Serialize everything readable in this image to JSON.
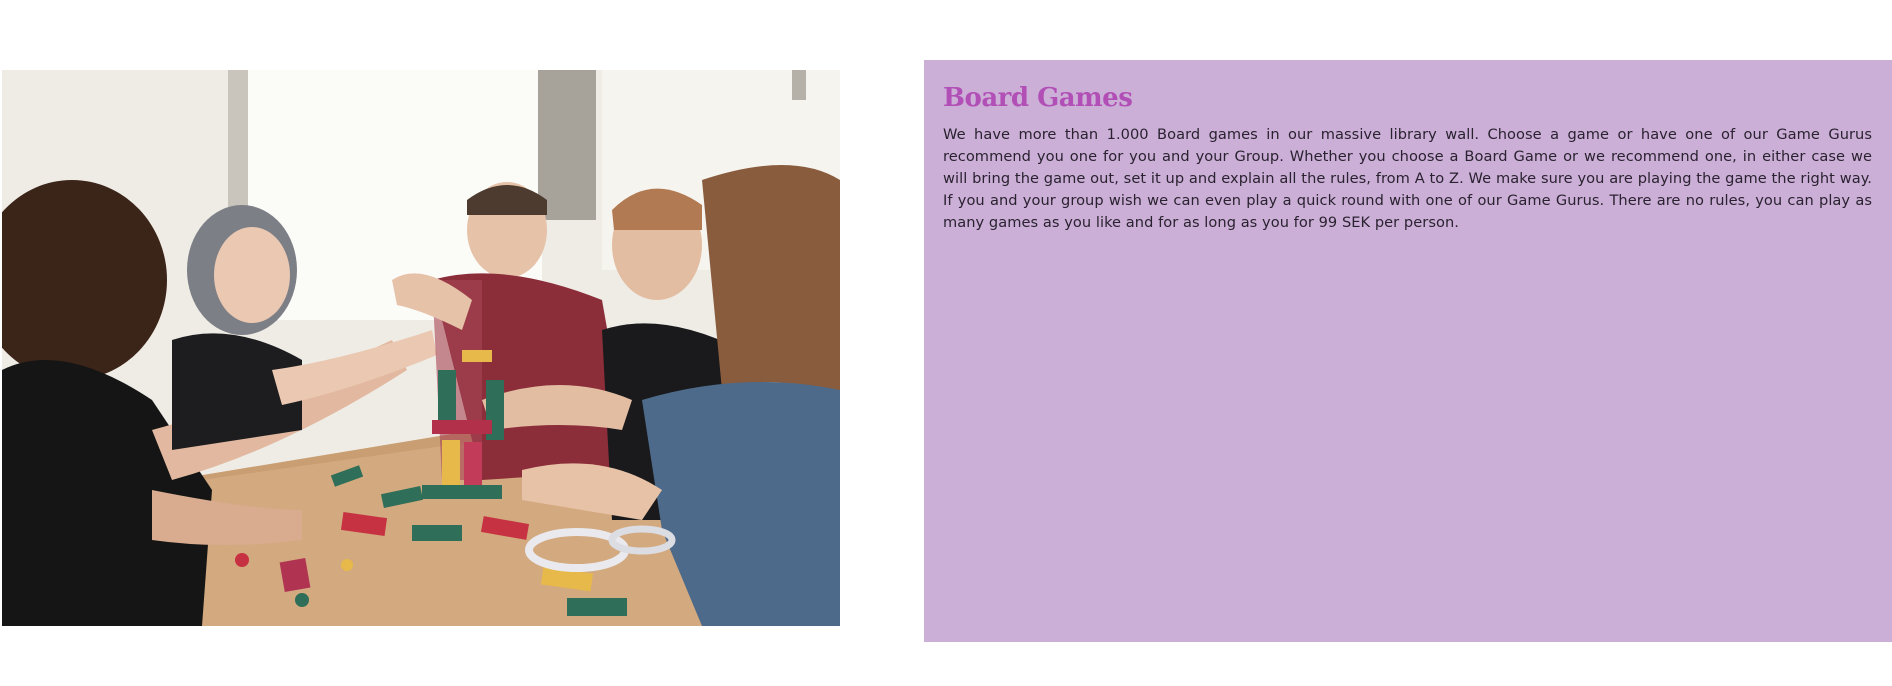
{
  "hero_image": {
    "alt": "Group of friends playing a wooden block stacking board game at a table"
  },
  "board_games": {
    "title": "Board Games",
    "body": "We have more than 1.000 Board games in our massive library wall. Choose a game or have one of our Game Gurus recommend you one for you and your Group. Whether you choose a Board Game or we recommend one, in either case we will bring the game out, set it up and explain all the rules, from A to Z. We make sure you are playing the game the right way. If you and your group wish we can even play a quick round with one of our Game Gurus. There are no rules, you can play as many games as you like and for as long as you for 99 SEK per person."
  },
  "colors": {
    "panel_background": "#cbafd7",
    "title_color": "#b14fb6",
    "body_text_color": "#2a2230"
  }
}
